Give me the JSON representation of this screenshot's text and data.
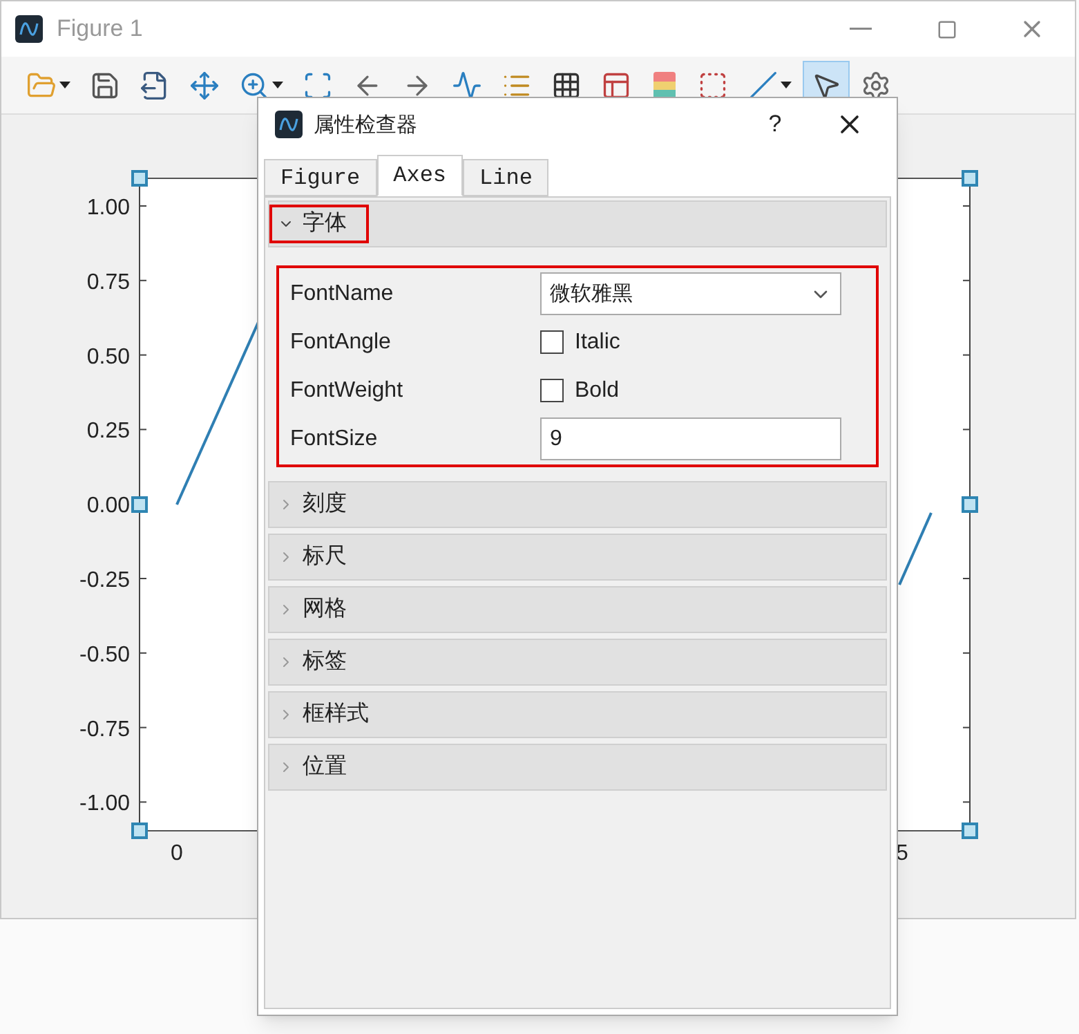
{
  "window": {
    "title": "Figure 1"
  },
  "toolbar": [
    {
      "kind": "open",
      "dropdown": true,
      "selected": false
    },
    {
      "kind": "save",
      "dropdown": false,
      "selected": false
    },
    {
      "kind": "export",
      "dropdown": false,
      "selected": false
    },
    {
      "kind": "pan",
      "dropdown": false,
      "selected": false
    },
    {
      "kind": "zoom",
      "dropdown": true,
      "selected": false
    },
    {
      "kind": "fit",
      "dropdown": false,
      "selected": false
    },
    {
      "kind": "back",
      "dropdown": false,
      "selected": false
    },
    {
      "kind": "forward",
      "dropdown": false,
      "selected": false
    },
    {
      "kind": "cursor",
      "dropdown": false,
      "selected": false
    },
    {
      "kind": "legend",
      "dropdown": false,
      "selected": false
    },
    {
      "kind": "grid",
      "dropdown": false,
      "selected": false
    },
    {
      "kind": "panels",
      "dropdown": false,
      "selected": false
    },
    {
      "kind": "colorbar",
      "dropdown": false,
      "selected": false
    },
    {
      "kind": "box",
      "dropdown": false,
      "selected": false
    },
    {
      "kind": "line",
      "dropdown": true,
      "selected": false
    },
    {
      "kind": "select",
      "dropdown": false,
      "selected": true
    },
    {
      "kind": "settings",
      "dropdown": false,
      "selected": false
    }
  ],
  "plot": {
    "y_ticks": [
      "1.00",
      "0.75",
      "0.50",
      "0.25",
      "0.00",
      "-0.25",
      "-0.50",
      "-0.75",
      "-1.00"
    ],
    "x_ticks": [
      "0",
      "5"
    ]
  },
  "dialog": {
    "title": "属性检查器",
    "help": "?",
    "tabs": [
      {
        "label": "Figure",
        "selected": false
      },
      {
        "label": "Axes",
        "selected": true
      },
      {
        "label": "Line",
        "selected": false
      }
    ],
    "sections": [
      {
        "title": "字体",
        "expanded": true,
        "highlighted": true,
        "properties": [
          {
            "name": "FontName",
            "kind": "dropdown",
            "value": "微软雅黑"
          },
          {
            "name": "FontAngle",
            "kind": "checkbox",
            "label": "Italic",
            "checked": false
          },
          {
            "name": "FontWeight",
            "kind": "checkbox",
            "label": "Bold",
            "checked": false
          },
          {
            "name": "FontSize",
            "kind": "text",
            "value": "9"
          }
        ]
      },
      {
        "title": "刻度",
        "expanded": false,
        "highlighted": false
      },
      {
        "title": "标尺",
        "expanded": false,
        "highlighted": false
      },
      {
        "title": "网格",
        "expanded": false,
        "highlighted": false
      },
      {
        "title": "标签",
        "expanded": false,
        "highlighted": false
      },
      {
        "title": "框样式",
        "expanded": false,
        "highlighted": false
      },
      {
        "title": "位置",
        "expanded": false,
        "highlighted": false
      }
    ]
  }
}
